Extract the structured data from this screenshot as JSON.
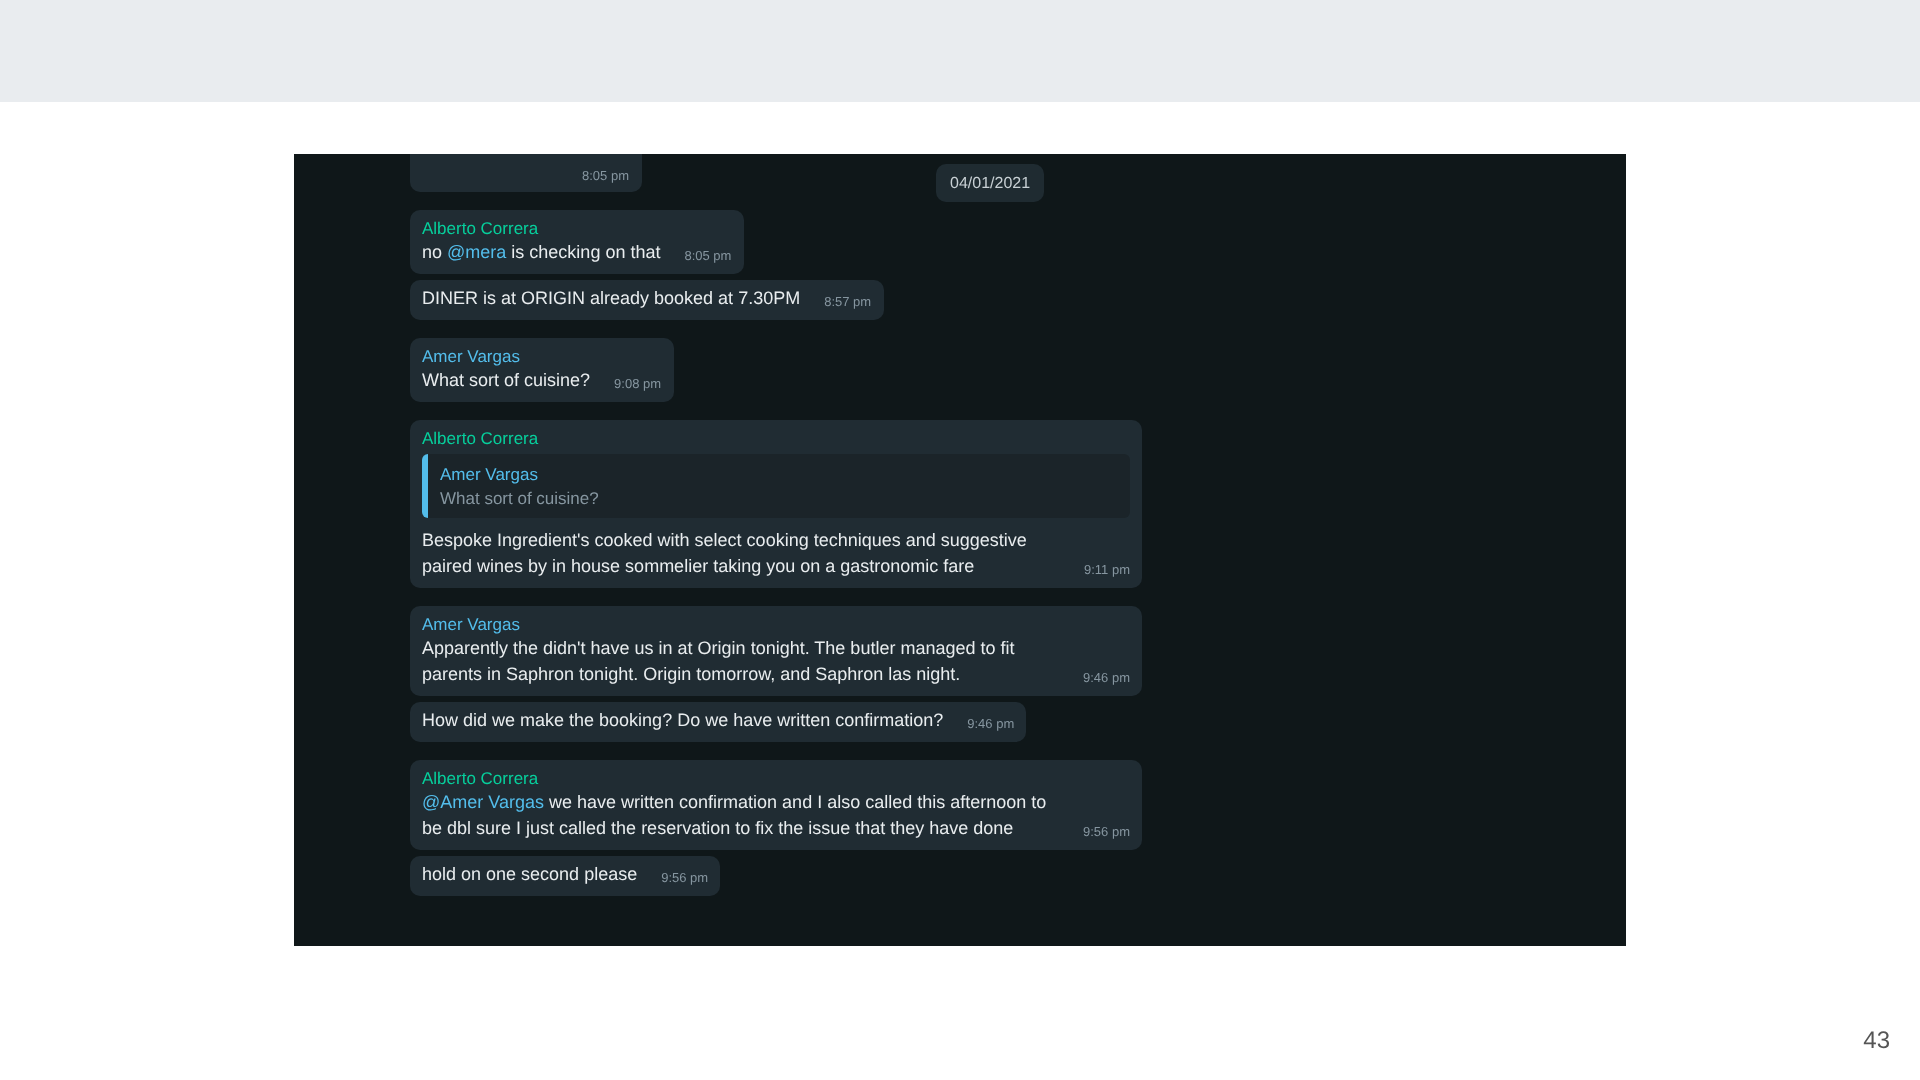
{
  "slide_number": "43",
  "chat": {
    "date_badge": "04/01/2021",
    "messages": [
      {
        "kind": "fragment",
        "time": "8:05 pm"
      },
      {
        "kind": "message",
        "sender": "Alberto Correra",
        "color": "#06cf9c",
        "parts": [
          {
            "kind": "plain",
            "text": "no "
          },
          {
            "kind": "mention",
            "text": "@mera"
          },
          {
            "kind": "plain",
            "text": " is checking on that"
          }
        ],
        "time": "8:05 pm"
      },
      {
        "kind": "message",
        "parts": [
          {
            "kind": "plain",
            "text": "DINER is at ORIGIN already booked at 7.30PM"
          }
        ],
        "time": "8:57 pm"
      },
      {
        "kind": "message",
        "sender": "Amer Vargas",
        "color": "#53bdeb",
        "parts": [
          {
            "kind": "plain",
            "text": "What sort of cuisine?"
          }
        ],
        "time": "9:08 pm"
      },
      {
        "kind": "message",
        "sender": "Alberto Correra",
        "color": "#06cf9c",
        "quote": {
          "sender": "Amer Vargas",
          "text": "What sort of cuisine?"
        },
        "parts": [
          {
            "kind": "plain",
            "text": "Bespoke Ingredient's cooked with select cooking techniques and suggestive paired wines by in house sommelier taking you on a gastronomic fare"
          }
        ],
        "time": "9:11 pm"
      },
      {
        "kind": "message",
        "sender": "Amer Vargas",
        "color": "#53bdeb",
        "parts": [
          {
            "kind": "plain",
            "text": "Apparently the didn't have us in at Origin tonight. The butler managed to fit parents in Saphron tonight. Origin tomorrow, and Saphron las night."
          }
        ],
        "time": "9:46 pm"
      },
      {
        "kind": "message",
        "parts": [
          {
            "kind": "plain",
            "text": "How did we make the booking? Do we have written confirmation?"
          }
        ],
        "time": "9:46 pm"
      },
      {
        "kind": "message",
        "sender": "Alberto Correra",
        "color": "#06cf9c",
        "parts": [
          {
            "kind": "mention",
            "text": "@Amer Vargas"
          },
          {
            "kind": "plain",
            "text": " we have written confirmation and I also called this afternoon to be dbl sure I just called the reservation to fix the issue that they have done"
          }
        ],
        "time": "9:56 pm"
      },
      {
        "kind": "message",
        "parts": [
          {
            "kind": "plain",
            "text": "hold on one second please"
          }
        ],
        "time": "9:56 pm"
      }
    ]
  }
}
